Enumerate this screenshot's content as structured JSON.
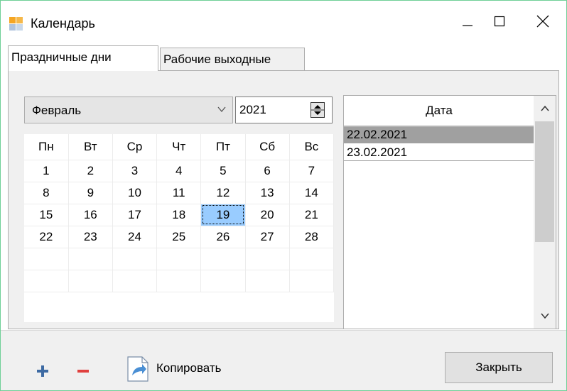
{
  "window": {
    "title": "Календарь",
    "minimize_icon": "minimize-icon",
    "maximize_icon": "maximize-icon",
    "close_icon": "close-icon"
  },
  "tabs": [
    {
      "label": "Праздничные дни",
      "active": true
    },
    {
      "label": "Рабочие выходные",
      "active": false
    }
  ],
  "month_select": {
    "value": "Февраль"
  },
  "year_spin": {
    "value": "2021"
  },
  "calendar": {
    "weekdays": [
      "Пн",
      "Вт",
      "Ср",
      "Чт",
      "Пт",
      "Сб",
      "Вс"
    ],
    "weeks": [
      [
        "1",
        "2",
        "3",
        "4",
        "5",
        "6",
        "7"
      ],
      [
        "8",
        "9",
        "10",
        "11",
        "12",
        "13",
        "14"
      ],
      [
        "15",
        "16",
        "17",
        "18",
        "19",
        "20",
        "21"
      ],
      [
        "22",
        "23",
        "24",
        "25",
        "26",
        "27",
        "28"
      ],
      [
        "",
        "",
        "",
        "",
        "",
        "",
        ""
      ],
      [
        "",
        "",
        "",
        "",
        "",
        "",
        ""
      ]
    ],
    "selected": "19",
    "selected_color": "#99ccff"
  },
  "date_list": {
    "header": "Дата",
    "rows": [
      "22.02.2021",
      "23.02.2021"
    ],
    "selected_row": 0
  },
  "toolbar": {
    "add_icon": "plus-icon",
    "remove_icon": "minus-icon",
    "copy_label": "Копировать",
    "close_label": "Закрыть",
    "add_color": "#3d6aa3",
    "remove_color": "#e0403e"
  }
}
